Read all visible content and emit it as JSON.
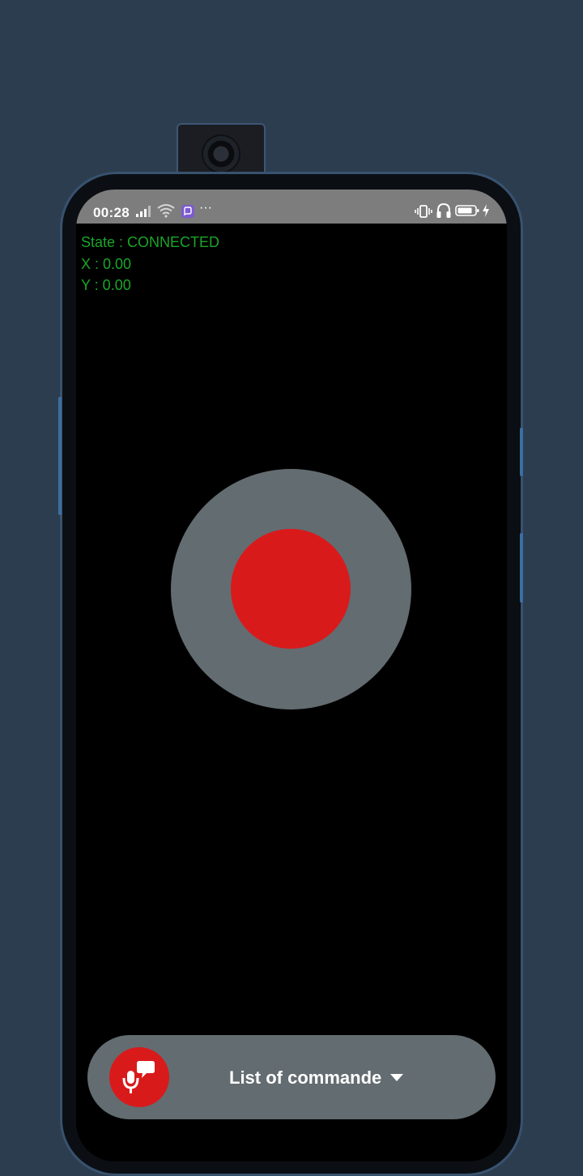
{
  "status_bar": {
    "time": "00:28",
    "overflow": "···",
    "icons": [
      "signal-icon",
      "wifi-icon",
      "viber-icon",
      "vibrate-icon",
      "headphones-icon",
      "battery-icon",
      "charging-icon"
    ]
  },
  "telemetry": {
    "state": "State : CONNECTED",
    "x": "X : 0.00",
    "y": "Y : 0.00"
  },
  "command_bar": {
    "label": "List of commande",
    "mic_icon": "voice-command-icon"
  },
  "colors": {
    "background": "#2c3d4f",
    "accent_red": "#d91a1b",
    "control_gray": "#636c70",
    "status_green": "#1aa628",
    "status_bar": "#7d7d7d"
  }
}
